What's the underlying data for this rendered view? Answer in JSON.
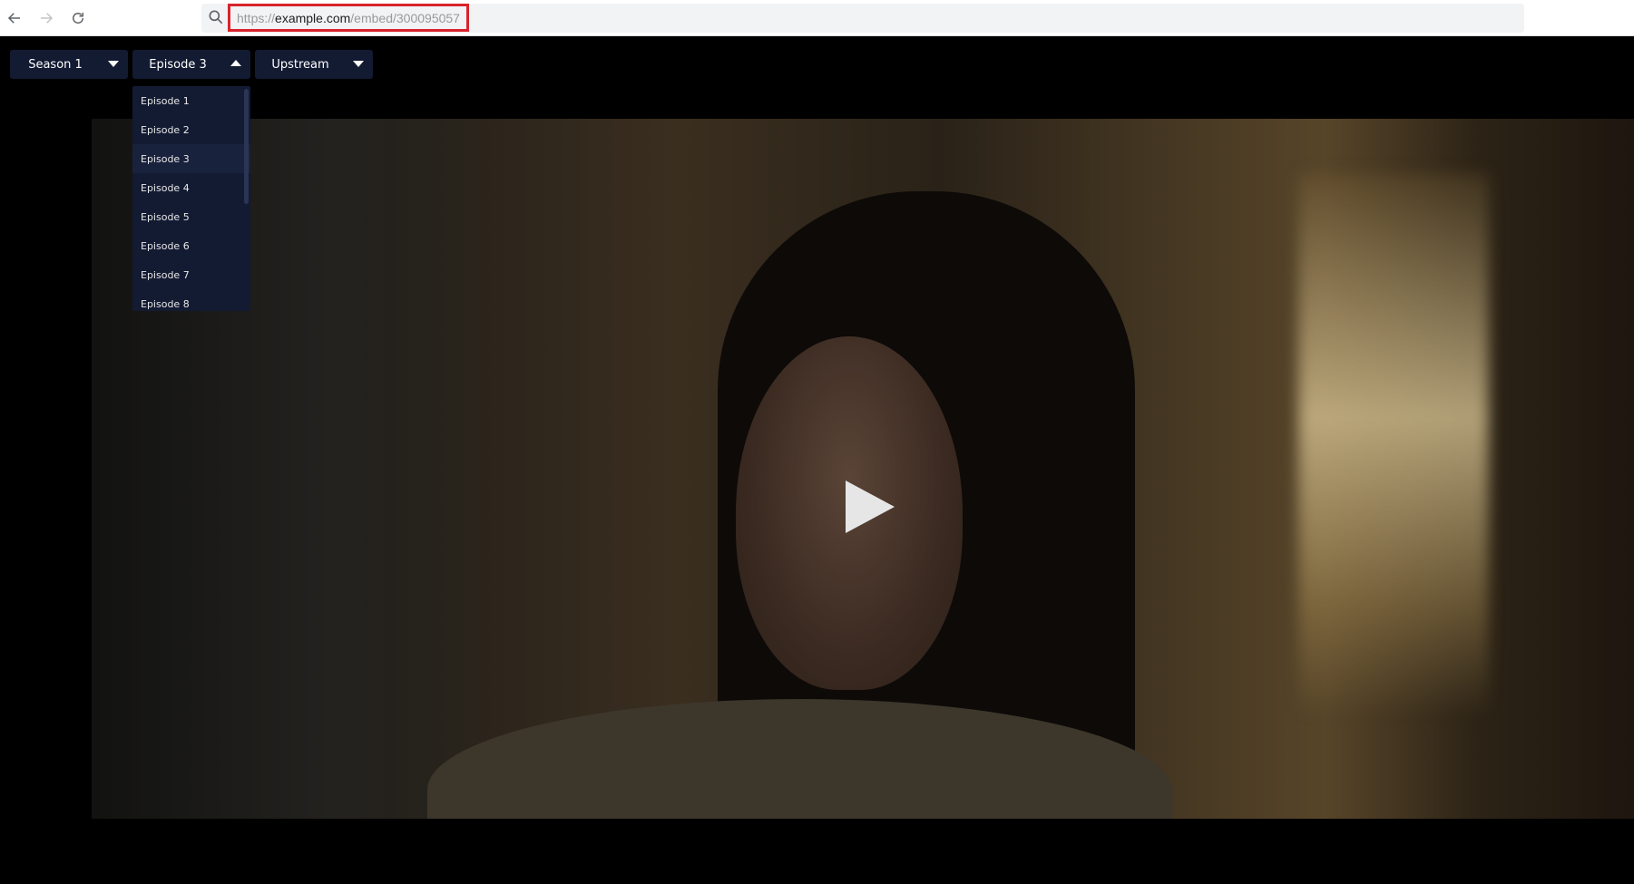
{
  "browser": {
    "url_prefix": "https://",
    "url_host": "example.com",
    "url_path": "/embed/300095057"
  },
  "player": {
    "season_dropdown": {
      "label": "Season 1",
      "state": "collapsed"
    },
    "episode_dropdown": {
      "label": "Episode 3",
      "state": "expanded",
      "options": [
        "Episode 1",
        "Episode 2",
        "Episode 3",
        "Episode 4",
        "Episode 5",
        "Episode 6",
        "Episode 7",
        "Episode 8"
      ]
    },
    "server_dropdown": {
      "label": "Upstream",
      "state": "collapsed"
    },
    "play_icon": "play-icon"
  },
  "colors": {
    "dropdown_bg": "#131b33",
    "url_highlight": "#d9232d"
  }
}
